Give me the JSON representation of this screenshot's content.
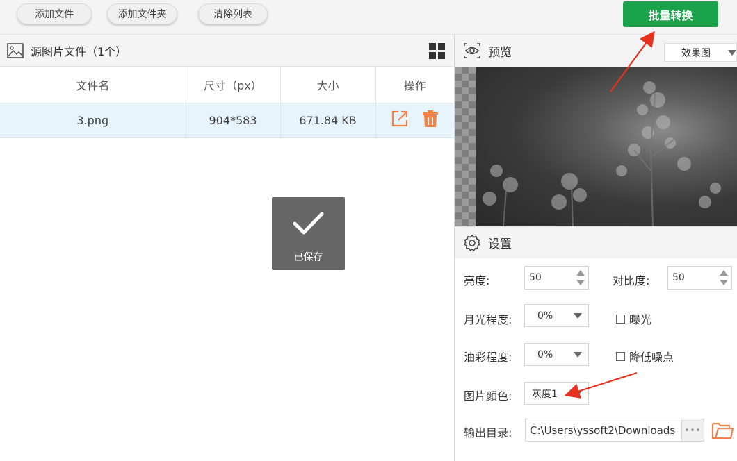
{
  "toolbar": {
    "add_file": "添加文件",
    "add_folder": "添加文件夹",
    "clear_list": "清除列表",
    "batch_convert": "批量转换"
  },
  "file_panel": {
    "title": "源图片文件（1个）",
    "columns": [
      "文件名",
      "尺寸（px）",
      "大小",
      "操作"
    ],
    "rows": [
      {
        "name": "3.png",
        "dimensions": "904*583",
        "size": "671.84 KB"
      }
    ],
    "toast": "已保存"
  },
  "preview": {
    "title": "预览",
    "mode": "效果图"
  },
  "settings": {
    "title": "设置",
    "brightness_label": "亮度:",
    "brightness_value": "50",
    "contrast_label": "对比度:",
    "contrast_value": "50",
    "moonlight_label": "月光程度:",
    "moonlight_value": "0%",
    "exposure_label": "曝光",
    "oil_label": "油彩程度:",
    "oil_value": "0%",
    "denoise_label": "降低噪点",
    "color_label": "图片颜色:",
    "color_value": "灰度1",
    "output_label": "输出目录:",
    "output_path": "C:\\Users\\yssoft2\\Downloads",
    "more_label": "•••"
  },
  "colors": {
    "primary": "#1aa34a",
    "action_icon": "#f0824a",
    "selected_row": "#e8f4fc",
    "annotation_arrow": "#e8301e"
  }
}
